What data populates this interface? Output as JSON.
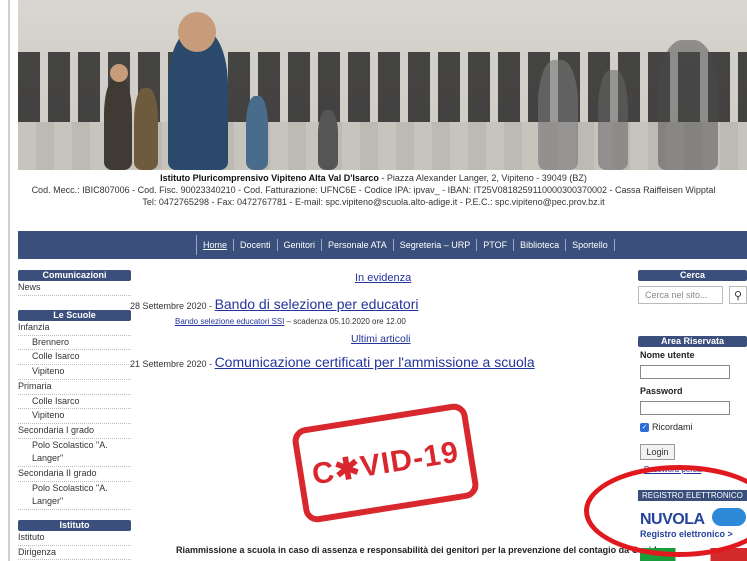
{
  "header": {
    "institute_name": "Istituto Pluricomprensivo Vipiteno Alta Val D'Isarco",
    "address": " - Piazza Alexander Langer, 2, Vipiteno - 39049 (BZ)",
    "line2": "Cod. Mecc.: IBIC807006 - Cod. Fisc. 90023340210 - Cod. Fatturazione: UFNC6E - Codice IPA: ipvav_ - IBAN: IT25V0818259110000300370002 - Cassa Raiffeisen Wipptal",
    "line3": "Tel: 0472765298 - Fax: 0472767781 - E-mail: spc.vipiteno@scuola.alto-adige.it - P.E.C.: spc.vipiteno@pec.prov.bz.it"
  },
  "nav": {
    "items": [
      "Home",
      "Docenti",
      "Genitori",
      "Personale ATA",
      "Segreteria – URP",
      "PTOF",
      "Biblioteca",
      "Sportello"
    ]
  },
  "sidebar": {
    "comunicazioni_title": "Comunicazioni",
    "comunicazioni_items": [
      "News"
    ],
    "scuole_title": "Le Scuole",
    "scuole_items": [
      "Infanzia",
      "Brennero",
      "Colle Isarco",
      "Vipiteno",
      "Primaria",
      "Colle Isarco",
      "Vipiteno",
      "Secondaria I grado",
      "Polo Scolastico \"A.",
      "Langer\"",
      "Secondaria II grado",
      "Polo Scolastico \"A.",
      "Langer\""
    ],
    "istituto_title": "Istituto",
    "istituto_items": [
      "Istituto",
      "Dirigenza"
    ]
  },
  "main": {
    "evidenza_title": "In evidenza",
    "article1_date": "28 Settembre 2020 - ",
    "article1_title": "Bando di selezione per educatori",
    "article1_sublink": "Bando selezione educatori SSI",
    "article1_subtext": " – scadenza 05.10.2020 ore 12.00",
    "ultimi_title": "Ultimi articoli",
    "article2_date": "21 Settembre 2020 - ",
    "article2_title": "Comunicazione certificati per l'ammissione a scuola",
    "stamp_text": "C✱VID-19",
    "bottom_text": "Riammissione a scuola in caso di assenza e responsabilità dei genitori per la prevenzione del contagio da Covid-"
  },
  "right": {
    "cerca_title": "Cerca",
    "search_placeholder": "Cerca nel sito...",
    "area_title": "Area Riservata",
    "username_label": "Nome utente",
    "password_label": "Password",
    "remember_label": "Ricordami",
    "login_label": "Login →",
    "lost_password": "Password persa",
    "registro_title": "REGISTRO ELETTRONICO",
    "nuvola_text": "NUVOLA",
    "nuvola_sub": "Registro elettronico >"
  },
  "colors": {
    "nav_bg": "#3a4f7b",
    "link": "#23349a",
    "highlight": "#e1191f"
  }
}
